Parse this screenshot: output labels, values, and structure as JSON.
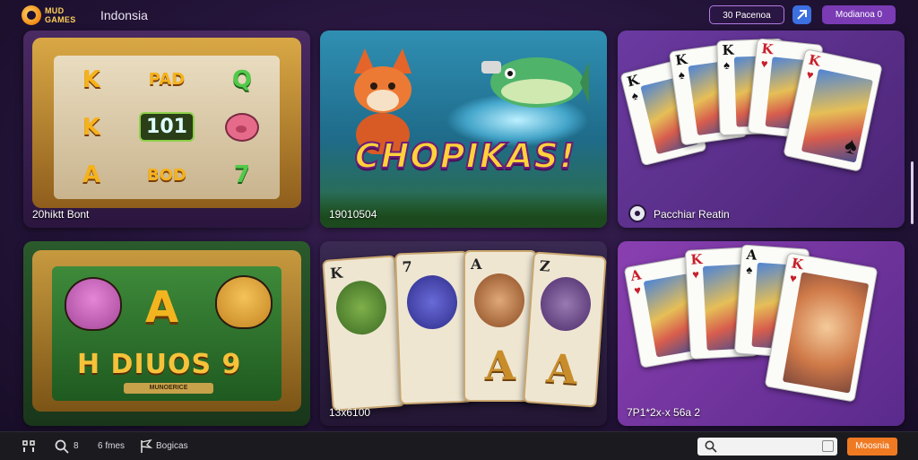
{
  "header": {
    "logo_text": "MUD GAMES",
    "region": "Indonsia",
    "button_outline": "30 Pacenoa",
    "button_filled": "Modianoa 0"
  },
  "tiles": [
    {
      "caption": "20hiktt Bont"
    },
    {
      "caption": "19010504",
      "title": "CHOPIKAS!"
    },
    {
      "caption": "Pacchiar Reatin"
    },
    {
      "caption": "",
      "title": "H DIUOS 9",
      "subtitle": "MUNOERICE"
    },
    {
      "caption": "13x6100"
    },
    {
      "caption": "7P1*2x-x 56a 2"
    }
  ],
  "slot": {
    "symbols": [
      "K",
      "PAD",
      "Q",
      "K",
      "101",
      "",
      "A",
      "BOD",
      "7"
    ]
  },
  "cards_t5": [
    "K",
    "7",
    "A",
    "Z"
  ],
  "bottom": {
    "icon1_label": "8",
    "label2": "6 fmes",
    "label3": "Bogicas",
    "cta": "Moosnia"
  }
}
